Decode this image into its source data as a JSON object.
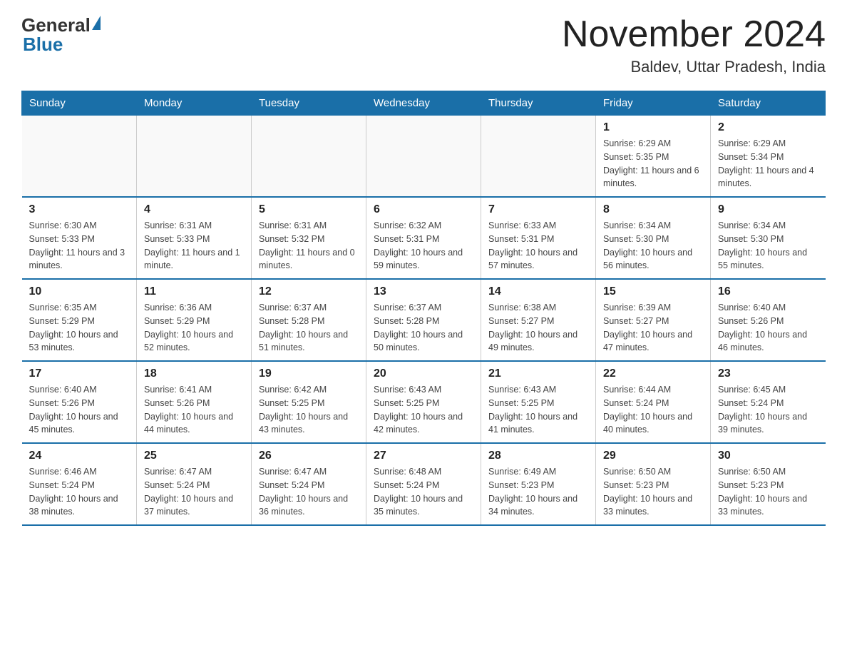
{
  "header": {
    "logo_general": "General",
    "logo_blue": "Blue",
    "month_title": "November 2024",
    "location": "Baldev, Uttar Pradesh, India"
  },
  "weekdays": [
    "Sunday",
    "Monday",
    "Tuesday",
    "Wednesday",
    "Thursday",
    "Friday",
    "Saturday"
  ],
  "weeks": [
    [
      {
        "day": "",
        "info": ""
      },
      {
        "day": "",
        "info": ""
      },
      {
        "day": "",
        "info": ""
      },
      {
        "day": "",
        "info": ""
      },
      {
        "day": "",
        "info": ""
      },
      {
        "day": "1",
        "info": "Sunrise: 6:29 AM\nSunset: 5:35 PM\nDaylight: 11 hours and 6 minutes."
      },
      {
        "day": "2",
        "info": "Sunrise: 6:29 AM\nSunset: 5:34 PM\nDaylight: 11 hours and 4 minutes."
      }
    ],
    [
      {
        "day": "3",
        "info": "Sunrise: 6:30 AM\nSunset: 5:33 PM\nDaylight: 11 hours and 3 minutes."
      },
      {
        "day": "4",
        "info": "Sunrise: 6:31 AM\nSunset: 5:33 PM\nDaylight: 11 hours and 1 minute."
      },
      {
        "day": "5",
        "info": "Sunrise: 6:31 AM\nSunset: 5:32 PM\nDaylight: 11 hours and 0 minutes."
      },
      {
        "day": "6",
        "info": "Sunrise: 6:32 AM\nSunset: 5:31 PM\nDaylight: 10 hours and 59 minutes."
      },
      {
        "day": "7",
        "info": "Sunrise: 6:33 AM\nSunset: 5:31 PM\nDaylight: 10 hours and 57 minutes."
      },
      {
        "day": "8",
        "info": "Sunrise: 6:34 AM\nSunset: 5:30 PM\nDaylight: 10 hours and 56 minutes."
      },
      {
        "day": "9",
        "info": "Sunrise: 6:34 AM\nSunset: 5:30 PM\nDaylight: 10 hours and 55 minutes."
      }
    ],
    [
      {
        "day": "10",
        "info": "Sunrise: 6:35 AM\nSunset: 5:29 PM\nDaylight: 10 hours and 53 minutes."
      },
      {
        "day": "11",
        "info": "Sunrise: 6:36 AM\nSunset: 5:29 PM\nDaylight: 10 hours and 52 minutes."
      },
      {
        "day": "12",
        "info": "Sunrise: 6:37 AM\nSunset: 5:28 PM\nDaylight: 10 hours and 51 minutes."
      },
      {
        "day": "13",
        "info": "Sunrise: 6:37 AM\nSunset: 5:28 PM\nDaylight: 10 hours and 50 minutes."
      },
      {
        "day": "14",
        "info": "Sunrise: 6:38 AM\nSunset: 5:27 PM\nDaylight: 10 hours and 49 minutes."
      },
      {
        "day": "15",
        "info": "Sunrise: 6:39 AM\nSunset: 5:27 PM\nDaylight: 10 hours and 47 minutes."
      },
      {
        "day": "16",
        "info": "Sunrise: 6:40 AM\nSunset: 5:26 PM\nDaylight: 10 hours and 46 minutes."
      }
    ],
    [
      {
        "day": "17",
        "info": "Sunrise: 6:40 AM\nSunset: 5:26 PM\nDaylight: 10 hours and 45 minutes."
      },
      {
        "day": "18",
        "info": "Sunrise: 6:41 AM\nSunset: 5:26 PM\nDaylight: 10 hours and 44 minutes."
      },
      {
        "day": "19",
        "info": "Sunrise: 6:42 AM\nSunset: 5:25 PM\nDaylight: 10 hours and 43 minutes."
      },
      {
        "day": "20",
        "info": "Sunrise: 6:43 AM\nSunset: 5:25 PM\nDaylight: 10 hours and 42 minutes."
      },
      {
        "day": "21",
        "info": "Sunrise: 6:43 AM\nSunset: 5:25 PM\nDaylight: 10 hours and 41 minutes."
      },
      {
        "day": "22",
        "info": "Sunrise: 6:44 AM\nSunset: 5:24 PM\nDaylight: 10 hours and 40 minutes."
      },
      {
        "day": "23",
        "info": "Sunrise: 6:45 AM\nSunset: 5:24 PM\nDaylight: 10 hours and 39 minutes."
      }
    ],
    [
      {
        "day": "24",
        "info": "Sunrise: 6:46 AM\nSunset: 5:24 PM\nDaylight: 10 hours and 38 minutes."
      },
      {
        "day": "25",
        "info": "Sunrise: 6:47 AM\nSunset: 5:24 PM\nDaylight: 10 hours and 37 minutes."
      },
      {
        "day": "26",
        "info": "Sunrise: 6:47 AM\nSunset: 5:24 PM\nDaylight: 10 hours and 36 minutes."
      },
      {
        "day": "27",
        "info": "Sunrise: 6:48 AM\nSunset: 5:24 PM\nDaylight: 10 hours and 35 minutes."
      },
      {
        "day": "28",
        "info": "Sunrise: 6:49 AM\nSunset: 5:23 PM\nDaylight: 10 hours and 34 minutes."
      },
      {
        "day": "29",
        "info": "Sunrise: 6:50 AM\nSunset: 5:23 PM\nDaylight: 10 hours and 33 minutes."
      },
      {
        "day": "30",
        "info": "Sunrise: 6:50 AM\nSunset: 5:23 PM\nDaylight: 10 hours and 33 minutes."
      }
    ]
  ]
}
